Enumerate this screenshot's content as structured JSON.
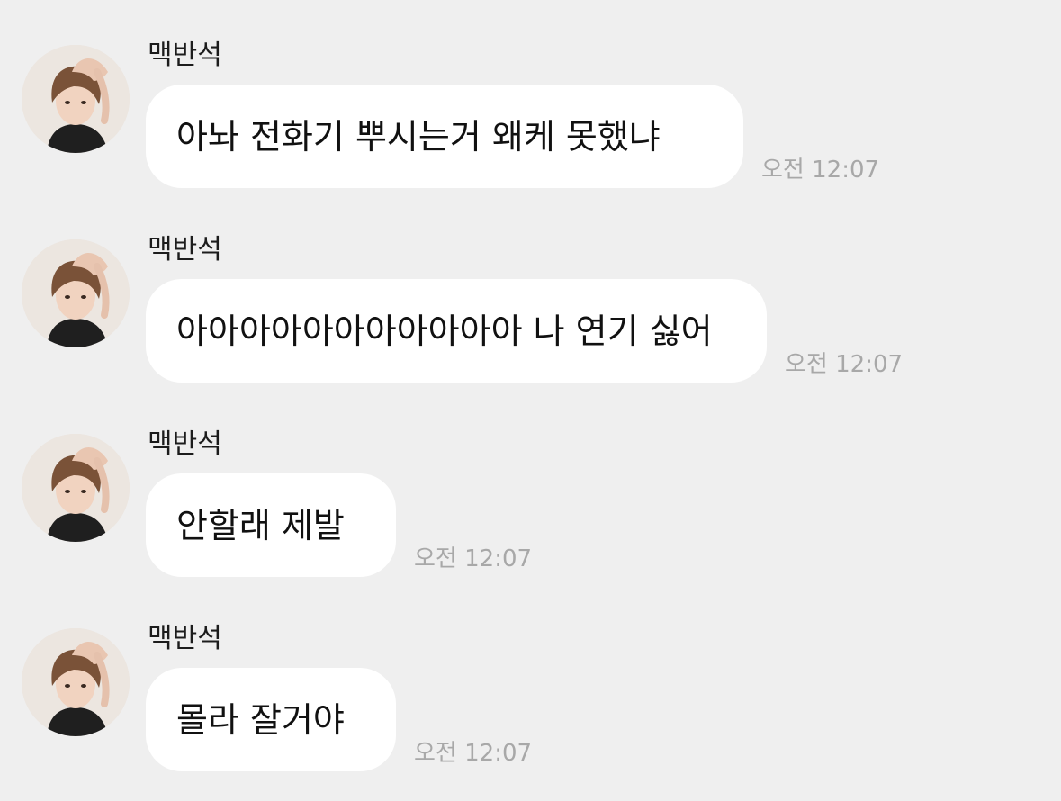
{
  "chat": {
    "messages": [
      {
        "sender": "맥반석",
        "text": "아놔 전화기 뿌시는거 왜케 못했냐",
        "time": "오전 12:07"
      },
      {
        "sender": "맥반석",
        "text": "아아아아아아아아아아아 나 연기 싫어",
        "time": "오전 12:07"
      },
      {
        "sender": "맥반석",
        "text": "안할래 제발",
        "time": "오전 12:07"
      },
      {
        "sender": "맥반석",
        "text": "몰라 잘거야",
        "time": "오전 12:07"
      }
    ]
  },
  "colors": {
    "background": "#efefef",
    "bubble": "#ffffff",
    "text": "#111111",
    "timestamp": "#a8a8a8"
  },
  "icons": {
    "avatar": "profile-photo"
  }
}
